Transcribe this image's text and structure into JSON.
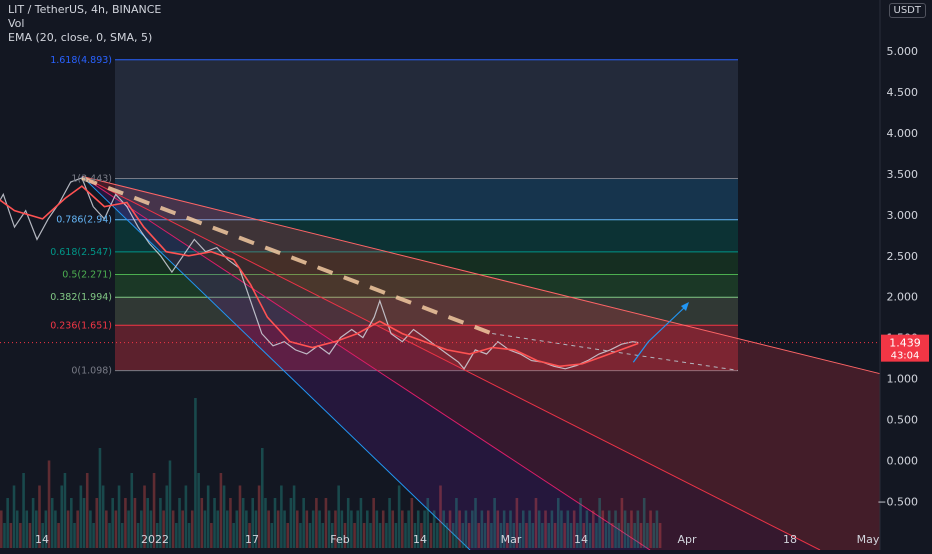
{
  "header": {
    "symbol_line": "LIT / TetherUS, 4h, BINANCE",
    "vol_label": "Vol",
    "ema_label": "EMA (20, close, 0, SMA, 5)",
    "currency_badge": "USDT"
  },
  "price_badge": {
    "price": "1.439",
    "countdown": "43:04"
  },
  "colors": {
    "background": "#131722",
    "price_line": "#f23645",
    "ema": "#ff5252",
    "fib_0": "#787b86",
    "fib_0236": "#f23645",
    "fib_0382": "#81c784",
    "fib_05": "#4caf50",
    "fib_0618": "#009688",
    "fib_0786": "#64b5f6",
    "fib_1": "#787b86",
    "fib_1618": "#2962ff",
    "accent_text": "#d1d4dc",
    "trend_dash": "#f2c9a0",
    "arrow": "#2196f3"
  },
  "chart_data": {
    "type": "line",
    "y_axis": {
      "ticks": [
        5.0,
        4.5,
        4.0,
        3.5,
        3.0,
        2.5,
        2.0,
        1.5,
        1.0,
        0.5,
        0.0,
        -0.5
      ],
      "tick_labels": [
        "5.000",
        "4.500",
        "4.000",
        "3.500",
        "3.000",
        "2.500",
        "2.000",
        "1.500",
        "1.000",
        "0.500",
        "0.000",
        "−0.500"
      ]
    },
    "x_axis": {
      "tick_labels": [
        "14",
        "2022",
        "17",
        "Feb",
        "14",
        "Mar",
        "14",
        "Apr",
        "18",
        "May"
      ]
    },
    "fib_levels": [
      {
        "ratio": 0,
        "price": 1.098,
        "label": "0(1.098)"
      },
      {
        "ratio": 0.236,
        "price": 1.651,
        "label": "0.236(1.651)"
      },
      {
        "ratio": 0.382,
        "price": 1.994,
        "label": "0.382(1.994)"
      },
      {
        "ratio": 0.5,
        "price": 2.271,
        "label": "0.5(2.271)"
      },
      {
        "ratio": 0.618,
        "price": 2.547,
        "label": "0.618(2.547)"
      },
      {
        "ratio": 0.786,
        "price": 2.94,
        "label": "0.786(2.94)"
      },
      {
        "ratio": 1,
        "price": 3.443,
        "label": "1(3.443)"
      },
      {
        "ratio": 1.618,
        "price": 4.893,
        "label": "1.618(4.893)"
      }
    ],
    "last_price": 1.439,
    "price_series": [
      {
        "d": -40,
        "v": 4.1
      },
      {
        "d": -38,
        "v": 3.75
      },
      {
        "d": -36,
        "v": 3.3
      },
      {
        "d": -34,
        "v": 3.45
      },
      {
        "d": -32,
        "v": 3.2
      },
      {
        "d": -31,
        "v": 3.5
      },
      {
        "d": -29,
        "v": 3.0
      },
      {
        "d": -27,
        "v": 3.25
      },
      {
        "d": -25,
        "v": 2.85
      },
      {
        "d": -23,
        "v": 3.05
      },
      {
        "d": -21,
        "v": 2.7
      },
      {
        "d": -19,
        "v": 2.95
      },
      {
        "d": -17,
        "v": 3.15
      },
      {
        "d": -15,
        "v": 3.4
      },
      {
        "d": -13,
        "v": 3.45
      },
      {
        "d": -11,
        "v": 3.1
      },
      {
        "d": -9,
        "v": 2.95
      },
      {
        "d": -7,
        "v": 3.25
      },
      {
        "d": -5,
        "v": 3.1
      },
      {
        "d": -3,
        "v": 2.85
      },
      {
        "d": -1,
        "v": 2.65
      },
      {
        "d": 1,
        "v": 2.5
      },
      {
        "d": 3,
        "v": 2.3
      },
      {
        "d": 5,
        "v": 2.5
      },
      {
        "d": 7,
        "v": 2.7
      },
      {
        "d": 9,
        "v": 2.55
      },
      {
        "d": 11,
        "v": 2.6
      },
      {
        "d": 13,
        "v": 2.45
      },
      {
        "d": 15,
        "v": 2.35
      },
      {
        "d": 17,
        "v": 1.95
      },
      {
        "d": 19,
        "v": 1.55
      },
      {
        "d": 21,
        "v": 1.4
      },
      {
        "d": 23,
        "v": 1.45
      },
      {
        "d": 25,
        "v": 1.35
      },
      {
        "d": 27,
        "v": 1.3
      },
      {
        "d": 29,
        "v": 1.4
      },
      {
        "d": 31,
        "v": 1.3
      },
      {
        "d": 33,
        "v": 1.5
      },
      {
        "d": 35,
        "v": 1.6
      },
      {
        "d": 37,
        "v": 1.5
      },
      {
        "d": 39,
        "v": 1.75
      },
      {
        "d": 40,
        "v": 1.95
      },
      {
        "d": 42,
        "v": 1.55
      },
      {
        "d": 44,
        "v": 1.45
      },
      {
        "d": 46,
        "v": 1.6
      },
      {
        "d": 48,
        "v": 1.5
      },
      {
        "d": 50,
        "v": 1.4
      },
      {
        "d": 52,
        "v": 1.3
      },
      {
        "d": 54,
        "v": 1.2
      },
      {
        "d": 55,
        "v": 1.12
      },
      {
        "d": 57,
        "v": 1.35
      },
      {
        "d": 59,
        "v": 1.3
      },
      {
        "d": 61,
        "v": 1.45
      },
      {
        "d": 63,
        "v": 1.35
      },
      {
        "d": 65,
        "v": 1.3
      },
      {
        "d": 67,
        "v": 1.22
      },
      {
        "d": 69,
        "v": 1.2
      },
      {
        "d": 71,
        "v": 1.15
      },
      {
        "d": 73,
        "v": 1.12
      },
      {
        "d": 75,
        "v": 1.16
      },
      {
        "d": 77,
        "v": 1.22
      },
      {
        "d": 79,
        "v": 1.3
      },
      {
        "d": 81,
        "v": 1.35
      },
      {
        "d": 83,
        "v": 1.42
      },
      {
        "d": 85,
        "v": 1.45
      },
      {
        "d": 86,
        "v": 1.439
      }
    ],
    "ema_series": [
      {
        "d": -40,
        "v": 3.9
      },
      {
        "d": -35,
        "v": 3.35
      },
      {
        "d": -30,
        "v": 3.3
      },
      {
        "d": -25,
        "v": 3.05
      },
      {
        "d": -20,
        "v": 2.95
      },
      {
        "d": -16,
        "v": 3.2
      },
      {
        "d": -13,
        "v": 3.35
      },
      {
        "d": -9,
        "v": 3.1
      },
      {
        "d": -5,
        "v": 3.15
      },
      {
        "d": -2,
        "v": 2.85
      },
      {
        "d": 2,
        "v": 2.55
      },
      {
        "d": 6,
        "v": 2.5
      },
      {
        "d": 10,
        "v": 2.55
      },
      {
        "d": 14,
        "v": 2.45
      },
      {
        "d": 17,
        "v": 2.15
      },
      {
        "d": 20,
        "v": 1.75
      },
      {
        "d": 24,
        "v": 1.45
      },
      {
        "d": 28,
        "v": 1.38
      },
      {
        "d": 32,
        "v": 1.45
      },
      {
        "d": 36,
        "v": 1.55
      },
      {
        "d": 40,
        "v": 1.7
      },
      {
        "d": 44,
        "v": 1.55
      },
      {
        "d": 48,
        "v": 1.45
      },
      {
        "d": 52,
        "v": 1.35
      },
      {
        "d": 56,
        "v": 1.3
      },
      {
        "d": 60,
        "v": 1.38
      },
      {
        "d": 64,
        "v": 1.35
      },
      {
        "d": 68,
        "v": 1.22
      },
      {
        "d": 72,
        "v": 1.15
      },
      {
        "d": 76,
        "v": 1.18
      },
      {
        "d": 80,
        "v": 1.28
      },
      {
        "d": 84,
        "v": 1.38
      },
      {
        "d": 86,
        "v": 1.43
      }
    ],
    "volume": [
      3,
      2,
      4,
      2,
      5,
      3,
      2,
      6,
      3,
      2,
      4,
      3,
      5,
      2,
      3,
      7,
      4,
      3,
      2,
      5,
      6,
      3,
      4,
      2,
      3,
      5,
      4,
      6,
      3,
      2,
      4,
      8,
      5,
      3,
      2,
      4,
      3,
      5,
      2,
      4,
      3,
      6,
      4,
      2,
      3,
      5,
      4,
      3,
      6,
      2,
      4,
      3,
      5,
      7,
      3,
      2,
      4,
      3,
      5,
      2,
      3,
      12,
      6,
      4,
      3,
      5,
      2,
      4,
      3,
      6,
      5,
      3,
      4,
      2,
      3,
      5,
      4,
      3,
      2,
      4,
      3,
      5,
      8,
      4,
      3,
      2,
      4,
      3,
      5,
      3,
      2,
      4,
      5,
      3,
      2,
      4,
      3,
      2,
      3,
      4,
      3,
      2,
      4,
      3,
      2,
      3,
      5,
      3,
      2,
      4,
      3,
      2,
      3,
      4,
      2,
      3,
      2,
      4,
      3,
      2,
      3,
      2,
      4,
      3,
      2,
      5,
      3,
      2,
      3,
      4,
      2,
      3,
      2,
      3,
      4,
      2,
      3,
      2,
      5,
      3,
      2,
      3,
      2,
      4,
      3,
      2,
      3,
      2,
      3,
      4,
      2,
      3,
      2,
      3,
      2,
      4,
      3,
      2,
      3,
      2,
      3,
      2,
      4,
      2,
      3,
      2,
      3,
      2,
      4,
      3,
      2,
      3,
      2,
      3,
      2,
      4,
      3,
      2,
      3,
      2,
      3,
      2,
      4,
      2,
      3,
      2,
      3,
      2,
      4,
      3,
      2,
      3,
      2,
      3,
      2,
      4,
      3,
      2,
      3,
      2,
      3,
      2,
      4,
      2,
      3,
      2,
      3,
      2
    ]
  }
}
